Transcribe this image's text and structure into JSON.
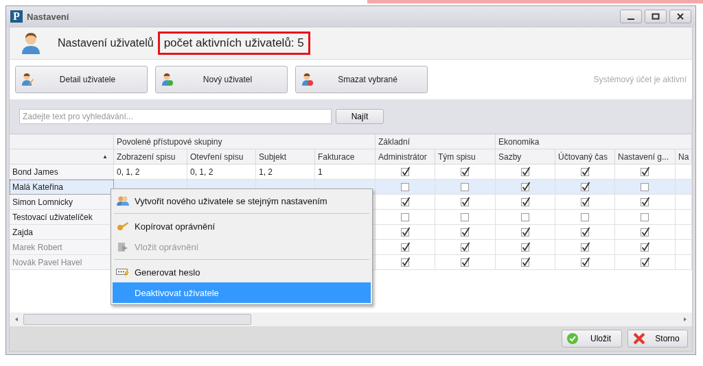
{
  "window": {
    "logo": "P",
    "title": "Nastavení"
  },
  "header": {
    "title": "Nastavení uživatelů",
    "highlight": "počet aktivních uživatelů: 5"
  },
  "toolbar": {
    "buttons": [
      "Detail uživatele",
      "Nový uživatel",
      "Smazat vybrané"
    ],
    "status": "Systémový účet je aktivní"
  },
  "search": {
    "placeholder": "Zadejte text pro vyhledávání...",
    "button": "Najít"
  },
  "grid": {
    "sort_indicator": "▲",
    "groups": [
      {
        "label": "Povolené přístupové skupiny",
        "columns": [
          {
            "label": "Zobrazení spisu",
            "kind": "text"
          },
          {
            "label": "Otevření spisu",
            "kind": "text"
          },
          {
            "label": "Subjekt",
            "kind": "text"
          },
          {
            "label": "Fakturace",
            "kind": "text"
          }
        ]
      },
      {
        "label": "Základní",
        "columns": [
          {
            "label": "Administrátor",
            "kind": "check"
          },
          {
            "label": "Tým spisu",
            "kind": "check"
          }
        ]
      },
      {
        "label": "Ekonomika",
        "columns": [
          {
            "label": "Sazby",
            "kind": "check"
          },
          {
            "label": "Účtovaný čas",
            "kind": "check"
          },
          {
            "label": "Nastavení g...",
            "kind": "check"
          },
          {
            "label": "Na",
            "kind": "check"
          }
        ]
      }
    ],
    "rows": [
      {
        "name": "Bond James",
        "selected": false,
        "inactive": false,
        "values": [
          "0, 1, 2",
          "0, 1, 2",
          "1, 2",
          "1"
        ],
        "checks": [
          true,
          true,
          true,
          true,
          true
        ]
      },
      {
        "name": "Malá Kateřina",
        "selected": true,
        "inactive": false,
        "checks": [
          false,
          false,
          true,
          true,
          false
        ]
      },
      {
        "name": "Simon Lomnicky",
        "selected": false,
        "inactive": false,
        "checks": [
          true,
          true,
          true,
          true,
          true
        ]
      },
      {
        "name": "Testovací uživatelíček",
        "selected": false,
        "inactive": false,
        "checks": [
          false,
          false,
          false,
          false,
          false
        ]
      },
      {
        "name": "Zajda",
        "selected": false,
        "inactive": false,
        "checks": [
          true,
          true,
          true,
          true,
          true
        ]
      },
      {
        "name": "Marek Robert",
        "selected": false,
        "inactive": true,
        "checks": [
          true,
          true,
          true,
          true,
          true
        ]
      },
      {
        "name": "Novák Pavel Havel",
        "selected": false,
        "inactive": true,
        "checks": [
          true,
          true,
          true,
          true,
          true
        ]
      }
    ]
  },
  "context_menu": {
    "groups": [
      [
        {
          "label": "Vytvořit nového uživatele se stejným nastavením",
          "disabled": false,
          "selected": false
        }
      ],
      [
        {
          "label": "Kopírovat oprávnění",
          "disabled": false,
          "selected": false
        },
        {
          "label": "Vložit oprávnění",
          "disabled": true,
          "selected": false
        }
      ],
      [
        {
          "label": "Generovat heslo",
          "disabled": false,
          "selected": false
        },
        {
          "label": "Deaktivovat uživatele",
          "disabled": false,
          "selected": true
        }
      ]
    ]
  },
  "footer": {
    "buttons": [
      {
        "label": "Uložit",
        "kind": "ok"
      },
      {
        "label": "Storno",
        "kind": "cancel"
      }
    ]
  }
}
